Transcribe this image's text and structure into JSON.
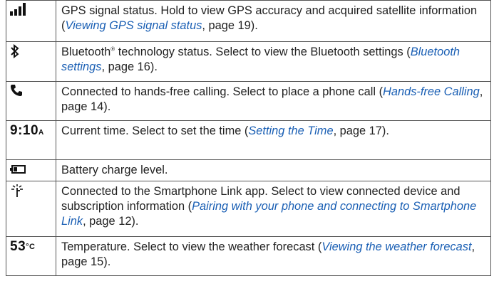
{
  "rows": [
    {
      "icon": "signal-bars-icon",
      "text_before": "GPS signal status. Hold to view GPS accuracy and acquired satellite information (",
      "link": "Viewing GPS signal status",
      "text_after": ", page 19)."
    },
    {
      "icon": "bluetooth-icon",
      "text_before": "Bluetooth",
      "sup": "®",
      "text_mid": " technology status. Select to view the Bluetooth settings (",
      "link": "Bluetooth settings",
      "text_after": ", page 16)."
    },
    {
      "icon": "phone-icon",
      "text_before": "Connected to hands-free calling. Select to place a phone call (",
      "link": "Hands-free Calling",
      "text_after": ", page 14)."
    },
    {
      "icon": "clock-text-icon",
      "icon_text": "9:10",
      "icon_suffix": "A",
      "text_before": "Current time. Select to set the time (",
      "link": "Setting the Time",
      "text_after": ", page 17)."
    },
    {
      "icon": "battery-icon",
      "text_before": "Battery charge level."
    },
    {
      "icon": "smartphone-link-icon",
      "text_before": "Connected to the Smartphone Link app. Select to view connected device and subscription information (",
      "link": "Pairing with your phone and connecting to Smartphone Link",
      "text_after": ", page 12)."
    },
    {
      "icon": "temperature-text-icon",
      "icon_text": "53",
      "icon_suffix": "°C",
      "text_before": "Temperature. Select to view the weather forecast (",
      "link": "Viewing the weather forecast",
      "text_after": ", page 15)."
    }
  ],
  "colors": {
    "link": "#1a5fb4",
    "border": "#555555",
    "text": "#222222"
  }
}
